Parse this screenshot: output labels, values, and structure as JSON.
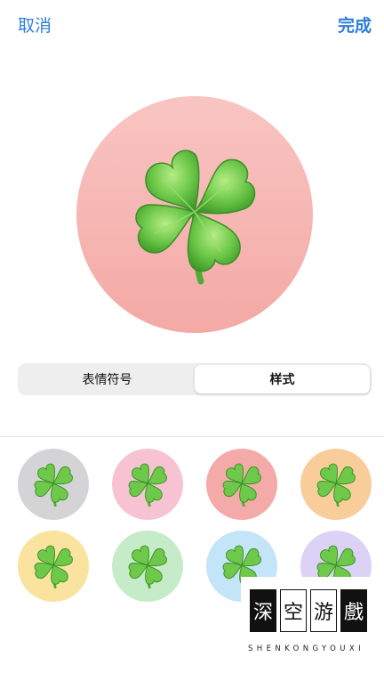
{
  "nav": {
    "cancel_label": "取消",
    "done_label": "完成"
  },
  "preview": {
    "icon": "four-leaf-clover-icon",
    "background": "#f6b7b3"
  },
  "segmented": {
    "tabs": [
      {
        "label": "表情符号",
        "selected": false
      },
      {
        "label": "样式",
        "selected": true
      }
    ]
  },
  "colors": [
    {
      "name": "gray",
      "hex": "#d4d4d6"
    },
    {
      "name": "pink",
      "hex": "#f7c3d2"
    },
    {
      "name": "coral",
      "hex": "#f4aaa8"
    },
    {
      "name": "orange",
      "hex": "#f8cd9a"
    },
    {
      "name": "yellow",
      "hex": "#f9e39e"
    },
    {
      "name": "green",
      "hex": "#c6ebc8"
    },
    {
      "name": "blue",
      "hex": "#c4e4f8"
    },
    {
      "name": "purple",
      "hex": "#dcd2f6"
    }
  ],
  "watermark": {
    "chars": [
      "深",
      "空",
      "游",
      "戲"
    ],
    "subtitle": "SHENKONGYOUXI"
  }
}
